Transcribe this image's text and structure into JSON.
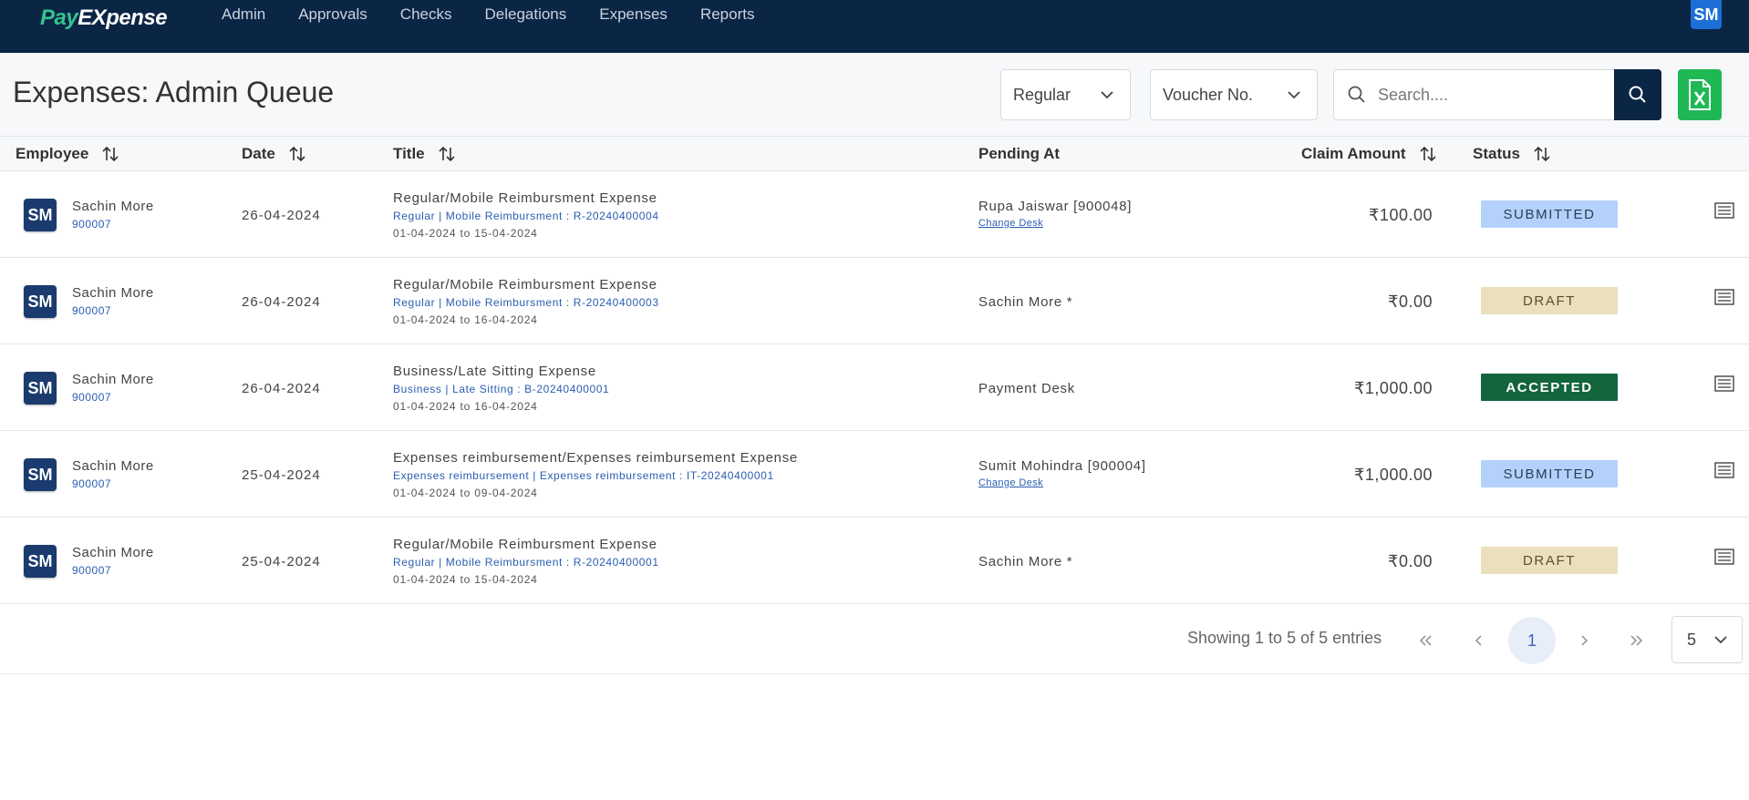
{
  "brand": {
    "pay": "Pay",
    "ex": "EX",
    "pense": "pense"
  },
  "nav": [
    "Admin",
    "Approvals",
    "Checks",
    "Delegations",
    "Expenses",
    "Reports"
  ],
  "user_initials": "SM",
  "page_title": "Expenses: Admin Queue",
  "filters": {
    "type": "Regular",
    "field": "Voucher No.",
    "search_placeholder": "Search...."
  },
  "columns": {
    "employee": "Employee",
    "date": "Date",
    "title": "Title",
    "pending_at": "Pending At",
    "claim_amount": "Claim Amount",
    "status": "Status"
  },
  "rows": [
    {
      "initials": "SM",
      "name": "Sachin More",
      "emp_id": "900007",
      "date": "26-04-2024",
      "title": "Regular/Mobile Reimbursment Expense",
      "subtitle": "Regular | Mobile Reimbursment : R-20240400004",
      "range": "01-04-2024 to 15-04-2024",
      "pending_at": "Rupa Jaiswar [900048]",
      "change_desk": "Change Desk",
      "amount": "₹100.00",
      "status": "SUBMITTED"
    },
    {
      "initials": "SM",
      "name": "Sachin More",
      "emp_id": "900007",
      "date": "26-04-2024",
      "title": "Regular/Mobile Reimbursment Expense",
      "subtitle": "Regular | Mobile Reimbursment : R-20240400003",
      "range": "01-04-2024 to 16-04-2024",
      "pending_at": "Sachin More *",
      "change_desk": "",
      "amount": "₹0.00",
      "status": "DRAFT"
    },
    {
      "initials": "SM",
      "name": "Sachin More",
      "emp_id": "900007",
      "date": "26-04-2024",
      "title": "Business/Late Sitting Expense",
      "subtitle": "Business | Late Sitting : B-20240400001",
      "range": "01-04-2024 to 16-04-2024",
      "pending_at": "Payment Desk",
      "change_desk": "",
      "amount": "₹1,000.00",
      "status": "ACCEPTED"
    },
    {
      "initials": "SM",
      "name": "Sachin More",
      "emp_id": "900007",
      "date": "25-04-2024",
      "title": "Expenses reimbursement/Expenses reimbursement Expense",
      "subtitle": "Expenses reimbursement | Expenses reimbursement : IT-20240400001",
      "range": "01-04-2024 to 09-04-2024",
      "pending_at": "Sumit Mohindra [900004]",
      "change_desk": "Change Desk",
      "amount": "₹1,000.00",
      "status": "SUBMITTED"
    },
    {
      "initials": "SM",
      "name": "Sachin More",
      "emp_id": "900007",
      "date": "25-04-2024",
      "title": "Regular/Mobile Reimbursment Expense",
      "subtitle": "Regular | Mobile Reimbursment : R-20240400001",
      "range": "01-04-2024 to 15-04-2024",
      "pending_at": "Sachin More *",
      "change_desk": "",
      "amount": "₹0.00",
      "status": "DRAFT"
    }
  ],
  "pagination": {
    "summary": "Showing 1 to 5 of 5 entries",
    "current_page": "1",
    "per_page": "5"
  },
  "colors": {
    "nav_bg": "#0b2545",
    "brand_green": "#34c38f",
    "excel_green": "#1fb855",
    "submitted": "#b3d1fb",
    "draft": "#ebe0bd",
    "accepted": "#13653c"
  }
}
